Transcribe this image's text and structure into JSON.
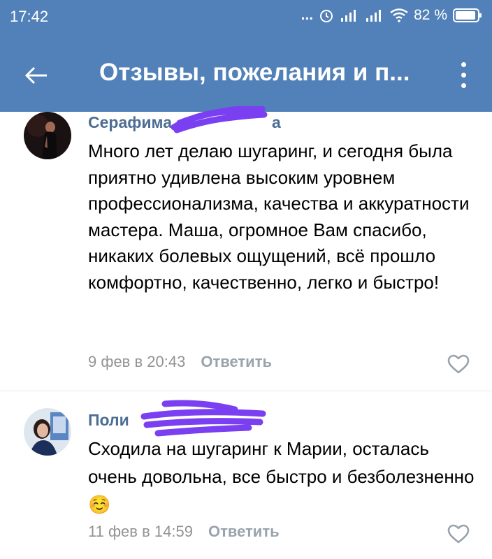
{
  "status_bar": {
    "time": "17:42",
    "dots": "...",
    "battery_percent": "82 %",
    "icons": [
      "alarm-icon",
      "signal-icon",
      "signal-icon",
      "wifi-icon",
      "battery-icon"
    ]
  },
  "toolbar": {
    "title": "Отзывы, пожелания и п...",
    "back_icon": "arrow-left-icon",
    "more_icon": "more-vertical-icon"
  },
  "comments": [
    {
      "author": "Серафима",
      "author_suffix": "а",
      "text": "Много лет делаю шугаринг, и сегодня была приятно удивлена высоким уровнем профессионализма, качества и аккуратности мастера. Маша, огромное Вам спасибо, никаких болевых ощущений, всё прошло комфортно, качественно, легко и быстро!",
      "date": "9 фев в 20:43",
      "reply_label": "Ответить"
    },
    {
      "author": "Поли",
      "text": "Сходила на шугаринг к Марии, осталась очень довольна, все быстро и безболезненно ☺️",
      "date": "11 фев в 14:59",
      "reply_label": "Ответить"
    }
  ],
  "colors": {
    "header": "#5181b8",
    "author": "#4d6d94",
    "scribble": "#7b3ff2",
    "meta": "#939393"
  }
}
